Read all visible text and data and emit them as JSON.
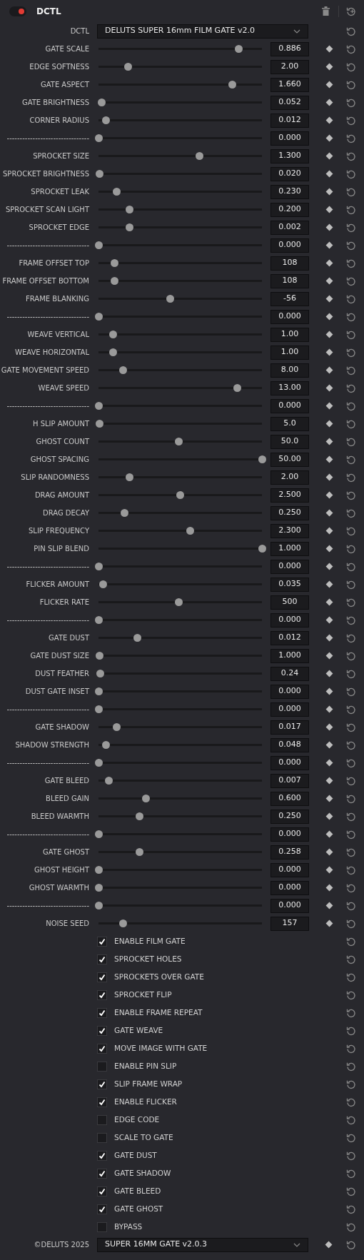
{
  "header": {
    "title": "DCTL",
    "enabled": true
  },
  "rows": [
    {
      "kind": "dropdown",
      "label": "DCTL",
      "value": "DELUTS SUPER 16mm FILM GATE v2.0",
      "keyframe": false
    },
    {
      "kind": "slider",
      "label": "GATE SCALE",
      "value": "0.886",
      "level": 0.86
    },
    {
      "kind": "slider",
      "label": "EDGE SOFTNESS",
      "value": "2.00",
      "level": 0.18
    },
    {
      "kind": "slider",
      "label": "GATE ASPECT",
      "value": "1.660",
      "level": 0.82
    },
    {
      "kind": "slider",
      "label": "GATE BRIGHTNESS",
      "value": "0.052",
      "level": 0.02
    },
    {
      "kind": "slider",
      "label": "CORNER RADIUS",
      "value": "0.012",
      "level": 0.045
    },
    {
      "kind": "slider",
      "label": "--------------------------------",
      "value": "0.000",
      "level": 0
    },
    {
      "kind": "slider",
      "label": "SPROCKET SIZE",
      "value": "1.300",
      "level": 0.62
    },
    {
      "kind": "slider",
      "label": "SPROCKET BRIGHTNESS",
      "value": "0.020",
      "level": 0.005
    },
    {
      "kind": "slider",
      "label": "SPROCKET LEAK",
      "value": "0.230",
      "level": 0.11
    },
    {
      "kind": "slider",
      "label": "SPROCKET SCAN LIGHT",
      "value": "0.200",
      "level": 0.19
    },
    {
      "kind": "slider",
      "label": "SPROCKET EDGE",
      "value": "0.002",
      "level": 0.19
    },
    {
      "kind": "slider",
      "label": "--------------------------------",
      "value": "0.000",
      "level": 0
    },
    {
      "kind": "slider",
      "label": "FRAME OFFSET TOP",
      "value": "108",
      "level": 0.1
    },
    {
      "kind": "slider",
      "label": "FRAME OFFSET BOTTOM",
      "value": "108",
      "level": 0.1
    },
    {
      "kind": "slider",
      "label": "FRAME BLANKING",
      "value": "-56",
      "level": 0.44
    },
    {
      "kind": "slider",
      "label": "--------------------------------",
      "value": "0.000",
      "level": 0
    },
    {
      "kind": "slider",
      "label": "WEAVE VERTICAL",
      "value": "1.00",
      "level": 0.09
    },
    {
      "kind": "slider",
      "label": "WEAVE HORIZONTAL",
      "value": "1.00",
      "level": 0.09
    },
    {
      "kind": "slider",
      "label": "GATE MOVEMENT SPEED",
      "value": "8.00",
      "level": 0.15
    },
    {
      "kind": "slider",
      "label": "WEAVE SPEED",
      "value": "13.00",
      "level": 0.85
    },
    {
      "kind": "slider",
      "label": "--------------------------------",
      "value": "0.000",
      "level": 0
    },
    {
      "kind": "slider",
      "label": "H SLIP AMOUNT",
      "value": "5.0",
      "level": 0.005
    },
    {
      "kind": "slider",
      "label": "GHOST COUNT",
      "value": "50.0",
      "level": 0.49
    },
    {
      "kind": "slider",
      "label": "GHOST SPACING",
      "value": "50.00",
      "level": 1
    },
    {
      "kind": "slider",
      "label": "SLIP RANDOMNESS",
      "value": "2.00",
      "level": 0.19
    },
    {
      "kind": "slider",
      "label": "DRAG AMOUNT",
      "value": "2.500",
      "level": 0.5
    },
    {
      "kind": "slider",
      "label": "DRAG DECAY",
      "value": "0.250",
      "level": 0.16
    },
    {
      "kind": "slider",
      "label": "SLIP FREQUENCY",
      "value": "2.300",
      "level": 0.56
    },
    {
      "kind": "slider",
      "label": "PIN SLIP BLEND",
      "value": "1.000",
      "level": 1
    },
    {
      "kind": "slider",
      "label": "--------------------------------",
      "value": "0.000",
      "level": 0
    },
    {
      "kind": "slider",
      "label": "FLICKER AMOUNT",
      "value": "0.035",
      "level": 0.03
    },
    {
      "kind": "slider",
      "label": "FLICKER RATE",
      "value": "500",
      "level": 0.49
    },
    {
      "kind": "slider",
      "label": "--------------------------------",
      "value": "0.000",
      "level": 0
    },
    {
      "kind": "slider",
      "label": "GATE DUST",
      "value": "0.012",
      "level": 0.24
    },
    {
      "kind": "slider",
      "label": "GATE DUST SIZE",
      "value": "1.000",
      "level": 0.005
    },
    {
      "kind": "slider",
      "label": "DUST FEATHER",
      "value": "0.24",
      "level": 0.01
    },
    {
      "kind": "slider",
      "label": "DUST GATE INSET",
      "value": "0.000",
      "level": 0
    },
    {
      "kind": "slider",
      "label": "--------------------------------",
      "value": "0.000",
      "level": 0
    },
    {
      "kind": "slider",
      "label": "GATE SHADOW",
      "value": "0.017",
      "level": 0.11
    },
    {
      "kind": "slider",
      "label": "SHADOW STRENGTH",
      "value": "0.048",
      "level": 0.045
    },
    {
      "kind": "slider",
      "label": "--------------------------------",
      "value": "0.000",
      "level": 0
    },
    {
      "kind": "slider",
      "label": "GATE BLEED",
      "value": "0.007",
      "level": 0.065
    },
    {
      "kind": "slider",
      "label": "BLEED GAIN",
      "value": "0.600",
      "level": 0.29
    },
    {
      "kind": "slider",
      "label": "BLEED WARMTH",
      "value": "0.250",
      "level": 0.25
    },
    {
      "kind": "slider",
      "label": "--------------------------------",
      "value": "0.000",
      "level": 0
    },
    {
      "kind": "slider",
      "label": "GATE GHOST",
      "value": "0.258",
      "level": 0.25
    },
    {
      "kind": "slider",
      "label": "GHOST HEIGHT",
      "value": "0.000",
      "level": 0
    },
    {
      "kind": "slider",
      "label": "GHOST WARMTH",
      "value": "0.000",
      "level": 0
    },
    {
      "kind": "slider",
      "label": "--------------------------------",
      "value": "0.000",
      "level": 0
    },
    {
      "kind": "slider",
      "label": "NOISE SEED",
      "value": "157",
      "level": 0.15
    },
    {
      "kind": "checkbox",
      "label": "ENABLE FILM GATE",
      "checked": true
    },
    {
      "kind": "checkbox",
      "label": "SPROCKET HOLES",
      "checked": true
    },
    {
      "kind": "checkbox",
      "label": "SPROCKETS OVER GATE",
      "checked": true
    },
    {
      "kind": "checkbox",
      "label": "SPROCKET FLIP",
      "checked": true
    },
    {
      "kind": "checkbox",
      "label": "ENABLE FRAME REPEAT",
      "checked": true
    },
    {
      "kind": "checkbox",
      "label": "GATE WEAVE",
      "checked": true
    },
    {
      "kind": "checkbox",
      "label": "MOVE IMAGE WITH GATE",
      "checked": true
    },
    {
      "kind": "checkbox",
      "label": "ENABLE PIN SLIP",
      "checked": false
    },
    {
      "kind": "checkbox",
      "label": "SLIP FRAME WRAP",
      "checked": true
    },
    {
      "kind": "checkbox",
      "label": "ENABLE FLICKER",
      "checked": true
    },
    {
      "kind": "checkbox",
      "label": "EDGE CODE",
      "checked": false
    },
    {
      "kind": "checkbox",
      "label": "SCALE TO GATE",
      "checked": false
    },
    {
      "kind": "checkbox",
      "label": "GATE DUST",
      "checked": true
    },
    {
      "kind": "checkbox",
      "label": "GATE SHADOW",
      "checked": true
    },
    {
      "kind": "checkbox",
      "label": "GATE BLEED",
      "checked": true
    },
    {
      "kind": "checkbox",
      "label": "GATE GHOST",
      "checked": true
    },
    {
      "kind": "checkbox",
      "label": "BYPASS",
      "checked": false
    },
    {
      "kind": "dropdown",
      "label": "©DELUTS 2025",
      "value": "SUPER 16MM GATE v2.0.3",
      "keyframe": true
    }
  ]
}
